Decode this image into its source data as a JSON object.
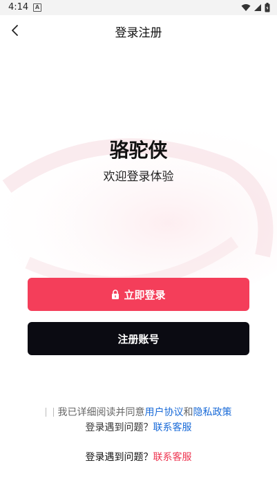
{
  "status_bar": {
    "time": "4:14",
    "notification_letter": "A",
    "icons": [
      "wifi-icon",
      "signal-icon",
      "battery-icon"
    ]
  },
  "header": {
    "title": "登录注册",
    "back_icon": "chevron-left-icon"
  },
  "main": {
    "app_name": "骆驼侠",
    "welcome": "欢迎登录体验"
  },
  "buttons": {
    "login_label": "立即登录",
    "login_icon": "lock-icon",
    "register_label": "注册账号"
  },
  "agreement": {
    "prefix": "我已详细阅读并同意",
    "user_agreement": "用户协议",
    "and": "和",
    "privacy_policy": "隐私政策"
  },
  "help_inline": {
    "question": "登录遇到问题？",
    "contact": "联系客服"
  },
  "help_bottom": {
    "question": "登录遇到问题？",
    "contact": "联系客服"
  },
  "colors": {
    "login_button": "#f43e5a",
    "register_button": "#0b0b12",
    "link_blue": "#1a6bd8",
    "link_red": "#ee3550"
  }
}
